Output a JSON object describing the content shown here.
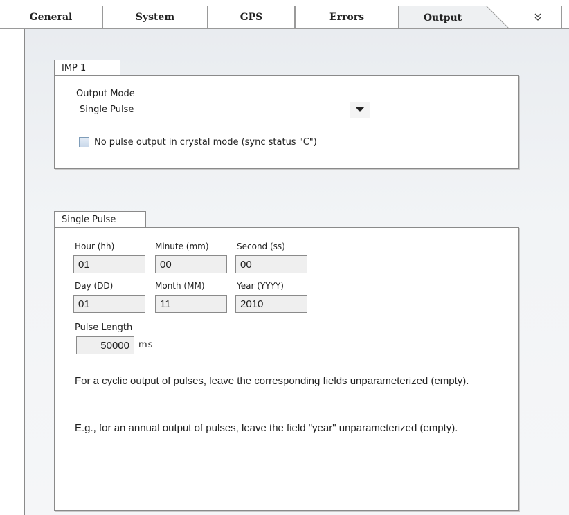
{
  "tabs": [
    {
      "label": "General"
    },
    {
      "label": "System"
    },
    {
      "label": "GPS"
    },
    {
      "label": "Errors"
    },
    {
      "label": "Output"
    }
  ],
  "tab_more_glyph": "»",
  "imp_group": {
    "title": "IMP 1",
    "output_mode_label": "Output Mode",
    "output_mode_value": "Single Pulse",
    "checkbox_label": "No pulse output in crystal mode (sync status \"C\")",
    "checkbox_checked": false
  },
  "pulse_group": {
    "title": "Single Pulse",
    "hour_label": "Hour (hh)",
    "minute_label": "Minute (mm)",
    "second_label": "Second (ss)",
    "hour_value": "01",
    "minute_value": "00",
    "second_value": "00",
    "day_label": "Day (DD)",
    "month_label": "Month (MM)",
    "year_label": "Year (YYYY)",
    "day_value": "01",
    "month_value": "11",
    "year_value": "2010",
    "pulse_length_label": "Pulse Length",
    "pulse_length_value": "50000",
    "pulse_length_unit": "ms",
    "info_1": "For a cyclic output of pulses, leave the corresponding fields unparameterized (empty).",
    "info_2": "E.g., for an annual output of pulses, leave the field \"year\" unparameterized (empty)."
  }
}
